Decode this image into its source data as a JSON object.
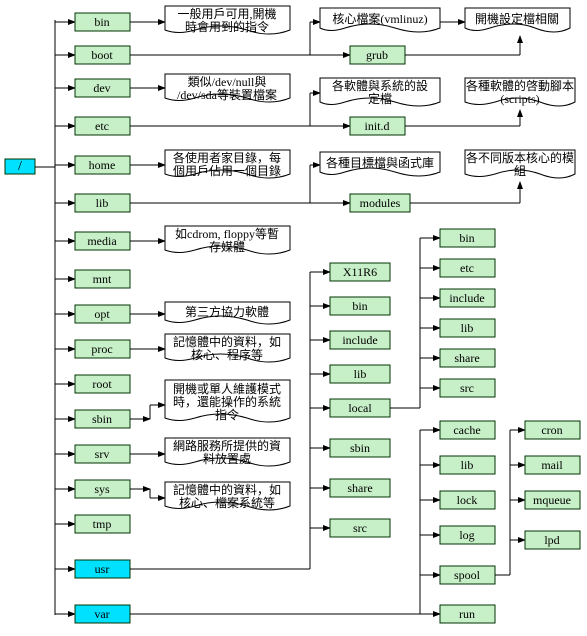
{
  "root": "/",
  "dirs": {
    "bin": "bin",
    "boot": "boot",
    "dev": "dev",
    "etc": "etc",
    "home": "home",
    "lib": "lib",
    "media": "media",
    "mnt": "mnt",
    "opt": "opt",
    "proc": "proc",
    "root": "root",
    "sbin": "sbin",
    "srv": "srv",
    "sys": "sys",
    "tmp": "tmp",
    "usr": "usr",
    "var": "var"
  },
  "sub": {
    "grub": "grub",
    "initd": "init.d",
    "modules": "modules",
    "X11R6": "X11R6",
    "bin": "bin",
    "include": "include",
    "lib": "lib",
    "local": "local",
    "sbin": "sbin",
    "share": "share",
    "src": "src",
    "etc": "etc",
    "cache": "cache",
    "lock": "lock",
    "log": "log",
    "spool": "spool",
    "run": "run",
    "cron": "cron",
    "mail": "mail",
    "mqueue": "mqueue",
    "lpd": "lpd"
  },
  "desc": {
    "bin1": "一般用戶可用,開機",
    "bin2": "時會用到的指令",
    "boot1": "核心檔案(vmlinuz)",
    "boot2": "開機設定檔相關",
    "dev1": "類似/dev/null與",
    "dev2": "/dev/sda等裝置檔案",
    "etc1": "各軟體與系統的設",
    "etc2": "定檔",
    "etc3": "各種軟體的啓動腳本",
    "etc4": "(scripts)",
    "home1": "各使用者家目錄，每",
    "home2": "個用戶佔用一個目錄",
    "lib1": "各種目標檔與函式庫",
    "lib2": "各不同版本核心的模",
    "lib3": "組",
    "media1": "如cdrom, floppy等暫",
    "media2": "存媒體",
    "opt1": "第三方協力軟體",
    "proc1": "記憶體中的資料，如",
    "proc2": "核心、程序等",
    "sbin1": "開機或單人維護模式",
    "sbin2": "時，還能操作的系統",
    "sbin3": "指令",
    "srv1": "網路服務所提供的資",
    "srv2": "料放置處",
    "sys1": "記憶體中的資料，如",
    "sys2": "核心、檔案系統等"
  }
}
